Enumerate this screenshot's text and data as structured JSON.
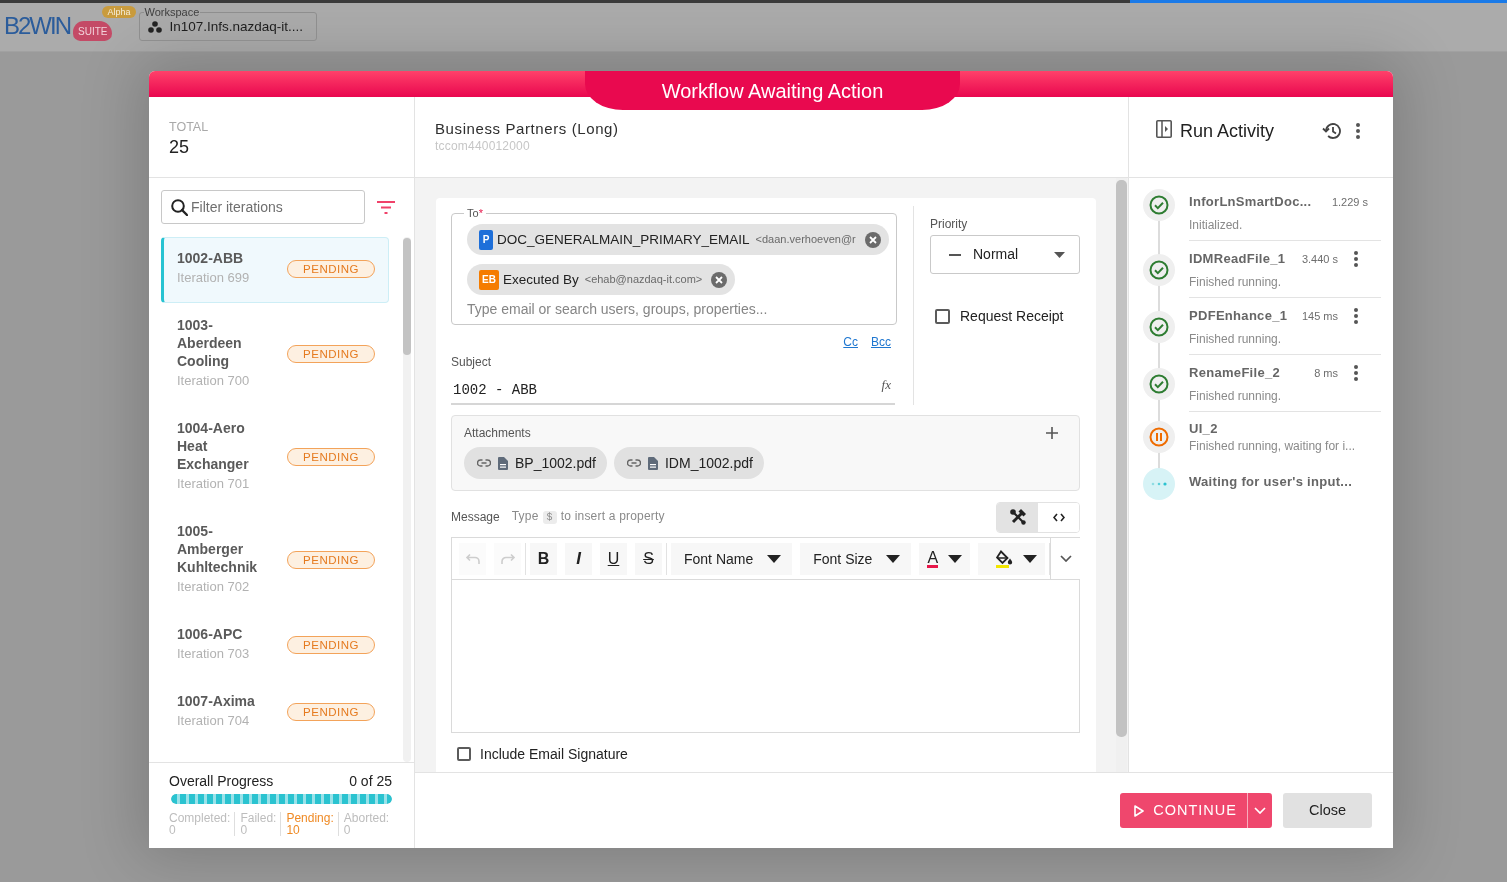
{
  "app_header": {
    "logo": {
      "text": "B2WIN",
      "tag": "SUITE",
      "badge": "Alpha"
    },
    "workspace": {
      "label": "Workspace",
      "value": "In107.Infs.nazdaq-it...."
    }
  },
  "dialog": {
    "title": "Workflow Awaiting Action"
  },
  "iterations": {
    "total_label": "TOTAL",
    "total": "25",
    "filter": {
      "placeholder": "Filter iterations"
    },
    "items": [
      {
        "name": "1002-ABB",
        "iteration": "Iteration 699",
        "status": "PENDING",
        "selected": true
      },
      {
        "name": "1003-Aberdeen Cooling",
        "iteration": "Iteration 700",
        "status": "PENDING",
        "selected": false
      },
      {
        "name": "1004-Aero Heat Exchanger",
        "iteration": "Iteration 701",
        "status": "PENDING",
        "selected": false
      },
      {
        "name": "1005-Amberger Kuhltechnik",
        "iteration": "Iteration 702",
        "status": "PENDING",
        "selected": false
      },
      {
        "name": "1006-APC",
        "iteration": "Iteration 703",
        "status": "PENDING",
        "selected": false
      },
      {
        "name": "1007-Axima",
        "iteration": "Iteration 704",
        "status": "PENDING",
        "selected": false
      }
    ],
    "progress": {
      "label": "Overall Progress",
      "reading": "0 of 25",
      "level": 1,
      "stats": [
        {
          "label": "Completed:",
          "value": "0",
          "highlighted": false
        },
        {
          "label": "Failed:",
          "value": "0",
          "highlighted": false
        },
        {
          "label": "Pending:",
          "value": "10",
          "highlighted": true
        },
        {
          "label": "Aborted:",
          "value": "0",
          "highlighted": false
        }
      ]
    }
  },
  "task": {
    "title": "Business Partners (Long)",
    "subtitle": "tccom440012000",
    "to": {
      "label": "To",
      "required_mark": "*",
      "recipients": [
        {
          "avatar": "P",
          "color": "#1e6fd9",
          "name": "DOC_GENERALMAIN_PRIMARY_EMAIL",
          "address": "<daan.verhoeven@r"
        },
        {
          "avatar": "EB",
          "color": "#f57c00",
          "name": "Executed By",
          "address": "<ehab@nazdaq-it.com>"
        }
      ],
      "placeholder": "Type email or search users, groups, properties..."
    },
    "copy_links": [
      "Cc",
      "Bcc"
    ],
    "subject": {
      "label": "Subject",
      "value": "1002 - ABB",
      "formula_button": "fx"
    },
    "priority": {
      "label": "Priority",
      "value": "Normal"
    },
    "request_receipt": {
      "label": "Request Receipt",
      "checked": false
    },
    "attachments": {
      "label": "Attachments",
      "files": [
        {
          "name": "BP_1002.pdf"
        },
        {
          "name": "IDM_1002.pdf"
        }
      ]
    },
    "message": {
      "label": "Message",
      "hint_before": "Type",
      "hint_token": "$",
      "hint_after": "to insert a property",
      "modes": [
        {
          "kind": "design",
          "selected": true
        },
        {
          "kind": "code",
          "selected": false
        }
      ],
      "toolbar": [
        [
          {
            "kind": "undo",
            "disabled": true
          },
          {
            "kind": "redo",
            "disabled": true
          }
        ],
        [
          {
            "kind": "bold",
            "label": "B",
            "disabled": false
          },
          {
            "kind": "italic",
            "label": "I",
            "disabled": false
          },
          {
            "kind": "underline",
            "label": "U",
            "disabled": false
          },
          {
            "kind": "strike",
            "label": "S",
            "disabled": false
          }
        ],
        [
          {
            "kind": "dropdown",
            "label": "Font Name",
            "disabled": false
          },
          {
            "kind": "dropdown",
            "label": "Font Size",
            "disabled": false
          },
          {
            "kind": "font_color",
            "label": "A",
            "disabled": false
          },
          {
            "kind": "highlight",
            "disabled": false
          }
        ]
      ]
    },
    "signature": {
      "label": "Include Email Signature",
      "checked": false
    }
  },
  "footer": {
    "continue": "CONTINUE",
    "close": "Close"
  },
  "activity": {
    "title": "Run Activity",
    "steps": [
      {
        "name": "InforLnSmartDoc...",
        "duration": "1.229 s",
        "detail": "Initialized.",
        "kind": "done",
        "menu": false
      },
      {
        "name": "IDMReadFile_1",
        "duration": "3.440 s",
        "detail": "Finished running.",
        "kind": "done",
        "menu": true
      },
      {
        "name": "PDFEnhance_1",
        "duration": "145 ms",
        "detail": "Finished running.",
        "kind": "done",
        "menu": true
      },
      {
        "name": "RenameFile_2",
        "duration": "8 ms",
        "detail": "Finished running.",
        "kind": "done",
        "menu": true
      },
      {
        "name": "UI_2",
        "detail": "Finished running, waiting for i...",
        "kind": "paused",
        "menu": false
      },
      {
        "name": "Waiting for user's input...",
        "kind": "waiting",
        "menu": false
      }
    ]
  }
}
